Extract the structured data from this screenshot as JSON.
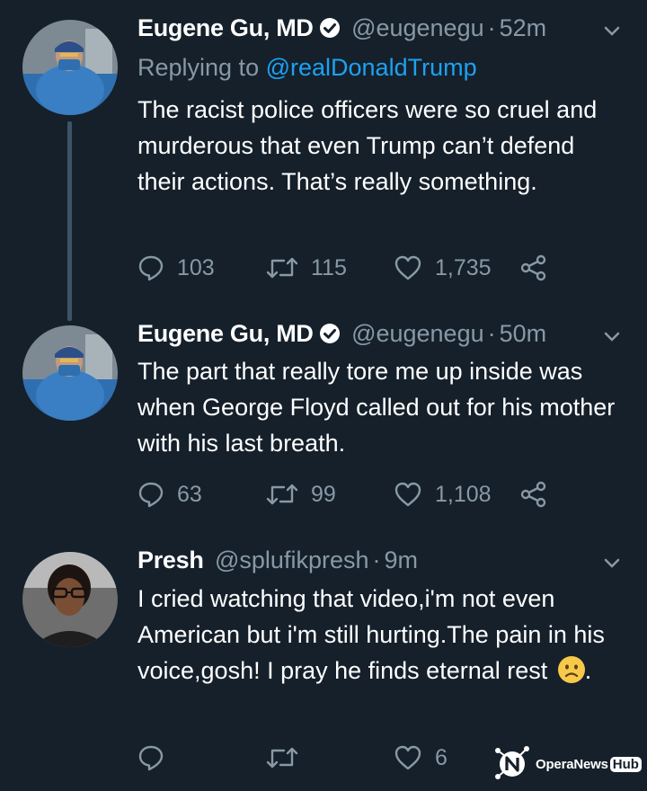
{
  "tweets": [
    {
      "name": "Eugene Gu, MD",
      "handle": "@eugenegu",
      "time": "52m",
      "replying_prefix": "Replying to ",
      "replying_to": "@realDonaldTrump",
      "text": "The racist police officers were so cruel and murderous that even Trump can’t defend their actions. That’s really something.",
      "replies": "103",
      "retweets": "115",
      "likes": "1,735"
    },
    {
      "name": "Eugene Gu, MD",
      "handle": "@eugenegu",
      "time": "50m",
      "text": "The part that really tore me up inside was when George Floyd called out for his mother with his last breath.",
      "replies": "63",
      "retweets": "99",
      "likes": "1,108"
    },
    {
      "name": "Presh",
      "handle": "@splufikpresh",
      "time": "9m",
      "text": "I cried watching that video,i'm not even American but i'm still hurting.The pain in his voice,gosh! I pray he finds eternal rest",
      "text_end": ".",
      "replies": "",
      "retweets": "",
      "likes": "6"
    }
  ],
  "watermark": {
    "brand": "OperaNews",
    "hub": "Hub"
  },
  "icons": [
    "verified-badge-icon",
    "chevron-down-icon",
    "reply-icon",
    "retweet-icon",
    "like-icon",
    "share-icon",
    "worried-face-emoji"
  ],
  "colors": {
    "background": "#15202b",
    "secondary_text": "#8899a6",
    "link": "#1da1f2"
  }
}
